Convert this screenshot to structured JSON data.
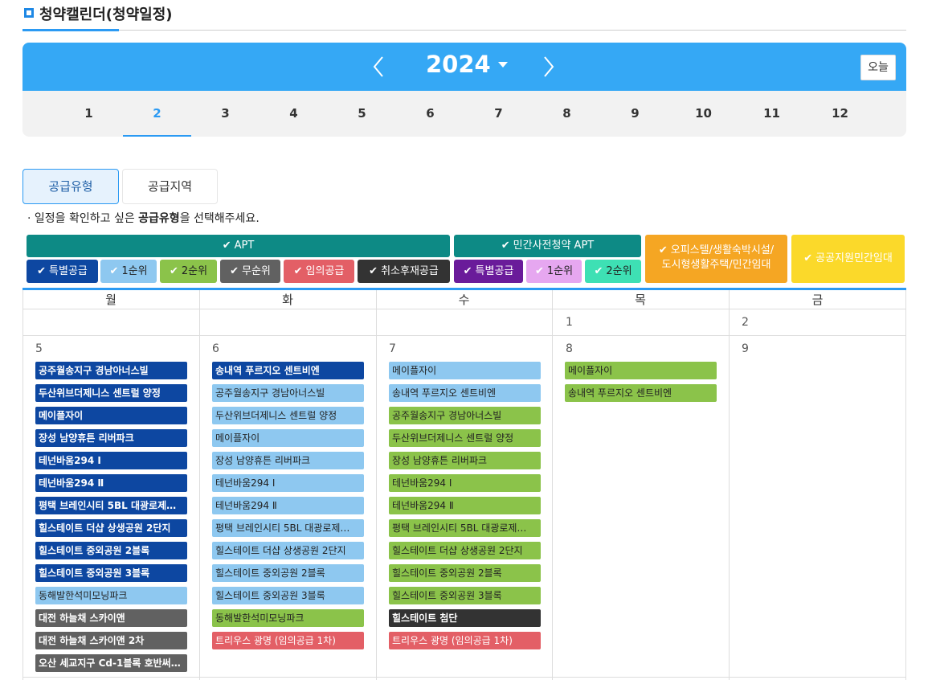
{
  "page": {
    "title": "청약캘린더(청약일정)"
  },
  "year_bar": {
    "year": "2024",
    "today_label": "오늘"
  },
  "months": [
    "1",
    "2",
    "3",
    "4",
    "5",
    "6",
    "7",
    "8",
    "9",
    "10",
    "11",
    "12"
  ],
  "active_month": "2",
  "tabs": [
    {
      "label": "공급유형",
      "active": true
    },
    {
      "label": "공급지역",
      "active": false
    }
  ],
  "instruction": {
    "prefix": "· 일정을 확인하고 싶은 ",
    "bold": "공급유형",
    "suffix": "을 선택해주세요."
  },
  "legend": {
    "check": "✔",
    "apt": "APT",
    "private_pre": "민간사전청약 APT",
    "officetel": [
      "오피스텔/생활숙박시설/",
      "도시형생활주택/민간임대"
    ],
    "public_rent": "공공지원민간임대",
    "apt_items": [
      "특별공급",
      "1순위",
      "2순위",
      "무순위",
      "임의공급",
      "취소후재공급"
    ],
    "private_items": [
      "특별공급",
      "1순위",
      "2순위"
    ],
    "colors": {
      "apt": "#0d8a85",
      "special": "#0d47a1",
      "first": "#8ec8f0",
      "second": "#8bc34a",
      "no_rank": "#616161",
      "random": "#e35f66",
      "cancel": "#333333",
      "private": "#0d8a85",
      "private_special": "#6a1b9a",
      "private_first": "#e6a7f0",
      "private_second": "#3ee0b4",
      "officetel": "#f5a623",
      "public_rent": "#fbd92a"
    }
  },
  "weekdays": [
    "월",
    "화",
    "수",
    "목",
    "금"
  ],
  "week1": {
    "thu": "1",
    "fri": "2"
  },
  "week2": {
    "mon": {
      "day": "5",
      "events": [
        {
          "t": "공주월송지구 경남아너스빌",
          "k": "special"
        },
        {
          "t": "두산위브더제니스 센트럴 양정",
          "k": "special"
        },
        {
          "t": "메이플자이",
          "k": "special"
        },
        {
          "t": "장성 남양휴튼 리버파크",
          "k": "special"
        },
        {
          "t": "테넌바움294 Ⅰ",
          "k": "special"
        },
        {
          "t": "테넌바움294 Ⅱ",
          "k": "special"
        },
        {
          "t": "평택 브레인시티 5BL 대광로제…",
          "k": "special"
        },
        {
          "t": "힐스테이트 더샵 상생공원 2단지",
          "k": "special"
        },
        {
          "t": "힐스테이트 중외공원 2블록",
          "k": "special"
        },
        {
          "t": "힐스테이트 중외공원 3블록",
          "k": "special"
        },
        {
          "t": "동해발한석미모닝파크",
          "k": "first"
        },
        {
          "t": "대전 하늘채 스카이앤",
          "k": "nornk"
        },
        {
          "t": "대전 하늘채 스카이앤 2차",
          "k": "nornk"
        },
        {
          "t": "오산 세교지구 Cd-1블록 호반써…",
          "k": "nornk"
        }
      ]
    },
    "tue": {
      "day": "6",
      "events": [
        {
          "t": "송내역 푸르지오 센트비엔",
          "k": "special"
        },
        {
          "t": "공주월송지구 경남아너스빌",
          "k": "first"
        },
        {
          "t": "두산위브더제니스 센트럴 양정",
          "k": "first"
        },
        {
          "t": "메이플자이",
          "k": "first"
        },
        {
          "t": "장성 남양휴튼 리버파크",
          "k": "first"
        },
        {
          "t": "테넌바움294 Ⅰ",
          "k": "first"
        },
        {
          "t": "테넌바움294 Ⅱ",
          "k": "first"
        },
        {
          "t": "평택 브레인시티 5BL 대광로제…",
          "k": "first"
        },
        {
          "t": "힐스테이트 더샵 상생공원 2단지",
          "k": "first"
        },
        {
          "t": "힐스테이트 중외공원 2블록",
          "k": "first"
        },
        {
          "t": "힐스테이트 중외공원 3블록",
          "k": "first"
        },
        {
          "t": "동해발한석미모닝파크",
          "k": "second"
        },
        {
          "t": "트리우스 광명 (임의공급 1차)",
          "k": "random"
        }
      ]
    },
    "wed": {
      "day": "7",
      "events": [
        {
          "t": "메이플자이",
          "k": "first"
        },
        {
          "t": "송내역 푸르지오 센트비엔",
          "k": "first"
        },
        {
          "t": "공주월송지구 경남아너스빌",
          "k": "second"
        },
        {
          "t": "두산위브더제니스 센트럴 양정",
          "k": "second"
        },
        {
          "t": "장성 남양휴튼 리버파크",
          "k": "second"
        },
        {
          "t": "테넌바움294 Ⅰ",
          "k": "second"
        },
        {
          "t": "테넌바움294 Ⅱ",
          "k": "second"
        },
        {
          "t": "평택 브레인시티 5BL 대광로제…",
          "k": "second"
        },
        {
          "t": "힐스테이트 더샵 상생공원 2단지",
          "k": "second"
        },
        {
          "t": "힐스테이트 중외공원 2블록",
          "k": "second"
        },
        {
          "t": "힐스테이트 중외공원 3블록",
          "k": "second"
        },
        {
          "t": "힐스테이트 첨단",
          "k": "cancel"
        },
        {
          "t": "트리우스 광명 (임의공급 1차)",
          "k": "random"
        }
      ]
    },
    "thu": {
      "day": "8",
      "events": [
        {
          "t": "메이플자이",
          "k": "second"
        },
        {
          "t": "송내역 푸르지오 센트비엔",
          "k": "second"
        }
      ]
    },
    "fri": {
      "day": "9",
      "events": []
    }
  }
}
